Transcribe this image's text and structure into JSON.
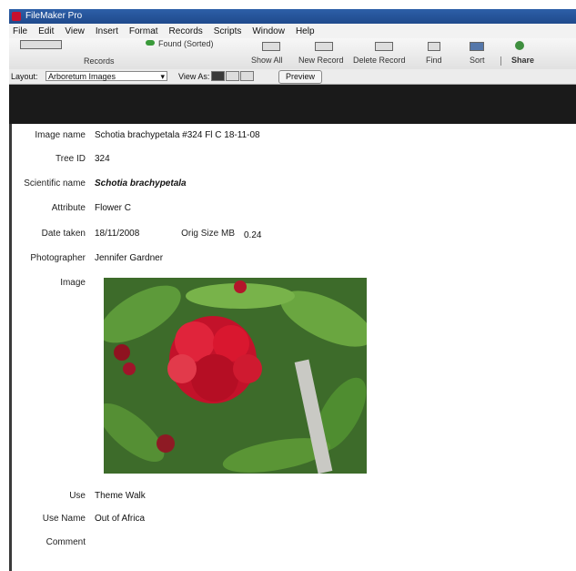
{
  "window": {
    "title": "FileMaker Pro"
  },
  "menu": [
    "File",
    "Edit",
    "View",
    "Insert",
    "Format",
    "Records",
    "Scripts",
    "Window",
    "Help"
  ],
  "toolbar": {
    "records_label": "Records",
    "found_label": "Found (Sorted)",
    "show_all": "Show All",
    "new_record": "New Record",
    "delete_record": "Delete Record",
    "find": "Find",
    "sort": "Sort",
    "share": "Share"
  },
  "layoutbar": {
    "layout_label": "Layout:",
    "layout_value": "Arboretum Images",
    "view_as_label": "View As:",
    "preview": "Preview"
  },
  "record": {
    "image_name_label": "Image name",
    "image_name": "Schotia brachypetala #324 Fl C 18-11-08",
    "tree_id_label": "Tree ID",
    "tree_id": "324",
    "scientific_name_label": "Scientific name",
    "scientific_name": "Schotia brachypetala",
    "attribute_label": "Attribute",
    "attribute": "Flower C",
    "date_taken_label": "Date taken",
    "date_taken": "18/11/2008",
    "orig_size_label": "Orig Size MB",
    "orig_size": "0.24",
    "photographer_label": "Photographer",
    "photographer": "Jennifer Gardner",
    "image_label": "Image",
    "use_label": "Use",
    "use": "Theme Walk",
    "use_name_label": "Use Name",
    "use_name": "Out of Africa",
    "comment_label": "Comment",
    "comment": ""
  }
}
